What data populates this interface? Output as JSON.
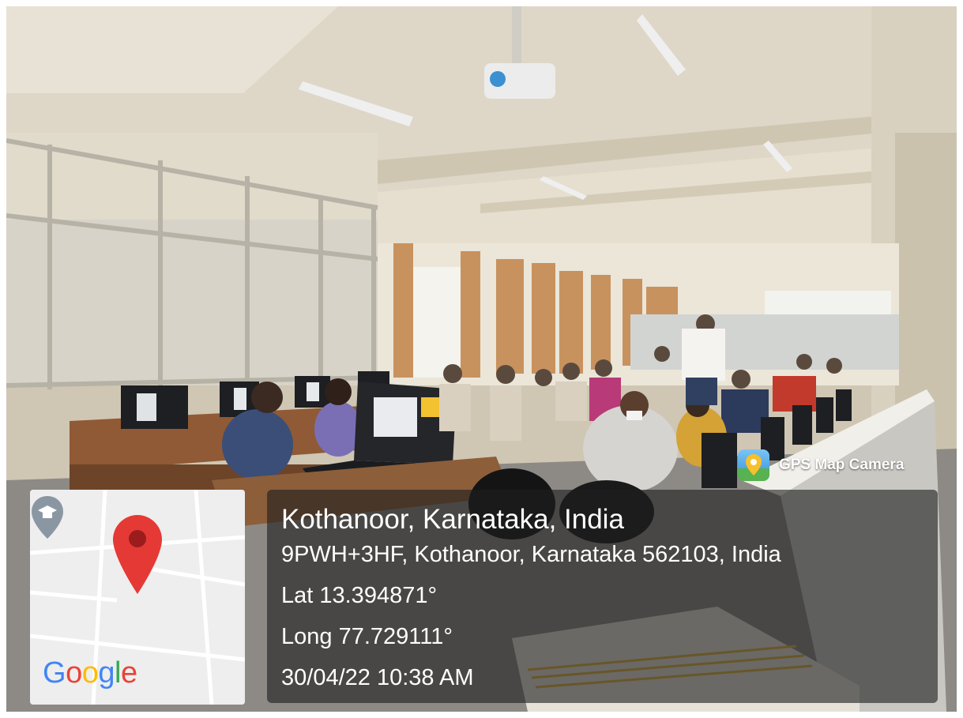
{
  "overlay": {
    "app_name": "GPS Map Camera",
    "location_title": "Kothanoor, Karnataka, India",
    "address": "9PWH+3HF, Kothanoor, Karnataka 562103, India",
    "latitude": "Lat 13.394871°",
    "longitude": "Long 77.729111°",
    "datetime": "30/04/22 10:38 AM"
  },
  "map": {
    "brand": "Google",
    "marker_icon": "map-pin-icon",
    "poi_icon": "graduation-cap-icon",
    "brand_colors": [
      "#4285F4",
      "#EA4335",
      "#FBBC05",
      "#4285F4",
      "#34A853",
      "#EA4335"
    ],
    "pin_color": "#E53935"
  },
  "app_icon": "gps-map-camera-icon"
}
